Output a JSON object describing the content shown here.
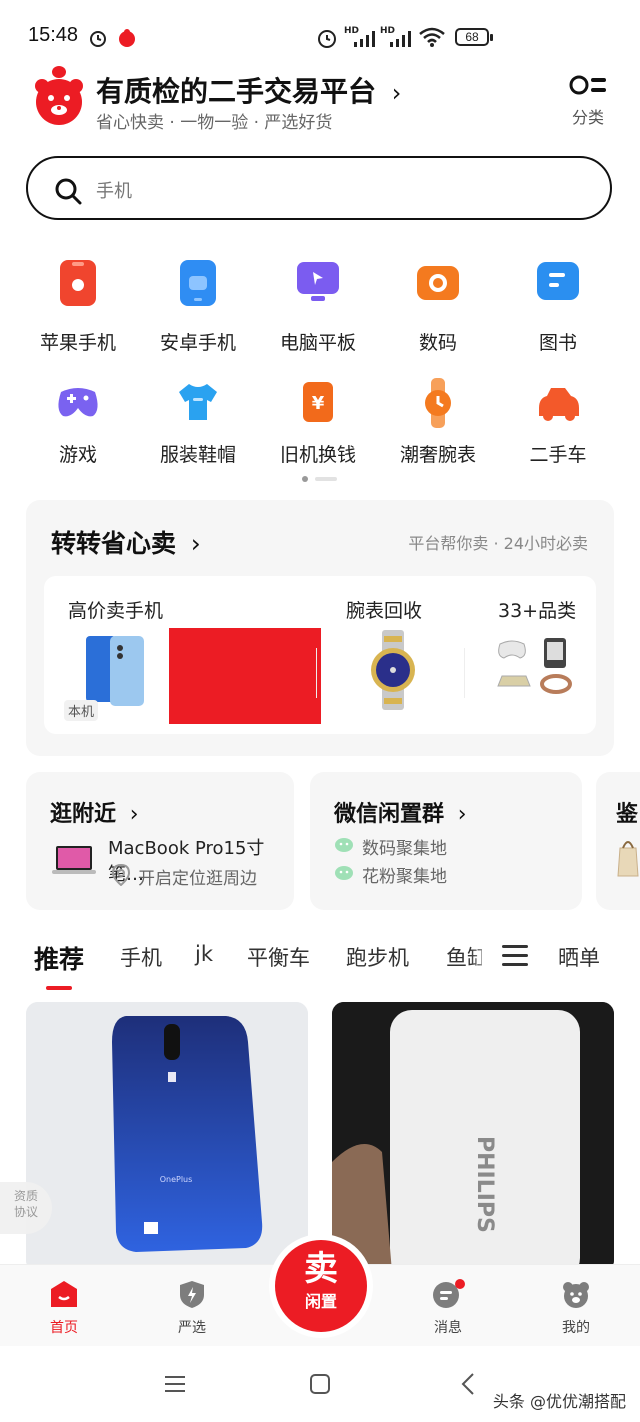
{
  "status_bar": {
    "time": "15:48",
    "battery": "68",
    "signal_label": "HD"
  },
  "header": {
    "title": "有质检的二手交易平台",
    "subtitle": "省心快卖 · 一物一验 · 严选好货",
    "category_label": "分类"
  },
  "search": {
    "placeholder": "手机"
  },
  "categories": [
    {
      "label": "苹果手机",
      "icon": "apple-phone-icon",
      "color": "#f0452e"
    },
    {
      "label": "安卓手机",
      "icon": "android-phone-icon",
      "color": "#2f8df3"
    },
    {
      "label": "电脑平板",
      "icon": "computer-tablet-icon",
      "color": "#7b5cf0"
    },
    {
      "label": "数码",
      "icon": "camera-icon",
      "color": "#f47a1f"
    },
    {
      "label": "图书",
      "icon": "book-icon",
      "color": "#2b8ff0"
    },
    {
      "label": "游戏",
      "icon": "gamepad-icon",
      "color": "#7a62f0"
    },
    {
      "label": "服装鞋帽",
      "icon": "tshirt-icon",
      "color": "#2aa2f0"
    },
    {
      "label": "旧机换钱",
      "icon": "yuan-exchange-icon",
      "color": "#f26a1b"
    },
    {
      "label": "潮奢腕表",
      "icon": "watch-icon",
      "color": "#f47a1f"
    },
    {
      "label": "二手车",
      "icon": "car-icon",
      "color": "#f3592a"
    }
  ],
  "sell_section": {
    "title": "转转省心卖",
    "subtitle": "平台帮你卖 · 24小时必卖",
    "col1_label": "高价卖手机",
    "col1_badge": "本机",
    "col2_label": "腕表回收",
    "col3_label": "33+品类"
  },
  "nearby": {
    "title": "逛附近",
    "item": "MacBook Pro15寸笔…",
    "locate": "开启定位逛周边"
  },
  "wechat": {
    "title": "微信闲置群",
    "line1": "数码聚集地",
    "line2": "花粉聚集地"
  },
  "third_card": {
    "title": "鉴"
  },
  "tabs": [
    "推荐",
    "手机",
    "jk",
    "平衡车",
    "跑步机",
    "鱼缸",
    "晒单"
  ],
  "products": [
    {
      "brand": "OnePlus",
      "color": "#2b4fc0"
    },
    {
      "brand": "PHILIPS",
      "color": "#efefef"
    }
  ],
  "float_badge": {
    "line1": "资质",
    "line2": "协议"
  },
  "bottom_nav": {
    "home": "首页",
    "select": "严选",
    "sell_big": "卖",
    "sell_small": "闲置",
    "messages": "消息",
    "mine": "我的"
  },
  "watermark": "头条 @优优潮搭配",
  "colors": {
    "accent": "#ec1c24",
    "text": "#222222",
    "muted": "#888888"
  }
}
